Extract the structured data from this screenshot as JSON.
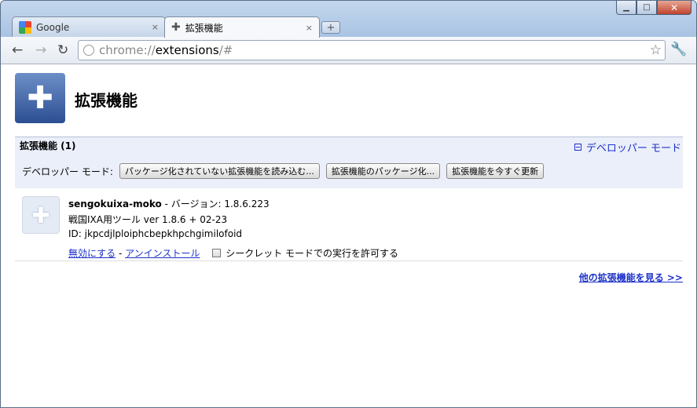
{
  "tabs": [
    {
      "title": "Google",
      "close": "×"
    },
    {
      "title": "拡張機能",
      "close": "×"
    }
  ],
  "new_tab": "+",
  "window_controls": {
    "minimize": "▁",
    "maximize": "□",
    "close": "✕"
  },
  "toolbar": {
    "back": "←",
    "forward": "→",
    "reload": "↻",
    "url": {
      "scheme": "chrome://",
      "host": "extensions",
      "rest": "/#"
    },
    "star": "☆",
    "wrench": "🔧"
  },
  "page": {
    "title": "拡張機能",
    "section_title": "拡張機能 (1)",
    "developer_mode_toggle": "デベロッパー モード",
    "developer_panel": {
      "label": "デベロッパー モード:",
      "buttons": [
        "パッケージ化されていない拡張機能を読み込む...",
        "拡張機能のパッケージ化...",
        "拡張機能を今すぐ更新"
      ]
    },
    "extension": {
      "name": "sengokuixa-moko",
      "version_text": " - バージョン: 1.8.6.223",
      "description": "戦国IXA用ツール ver 1.8.6 + 02-23",
      "id": "ID: jkpcdjlploiphcbepkhpchgimilofoid",
      "disable": "無効にする",
      "separator": " - ",
      "uninstall": "アンインストール",
      "incognito_label": "シークレット モードでの実行を許可する"
    },
    "more_extensions": "他の拡張機能を見る >>"
  },
  "icons": [
    "google-favicon",
    "puzzle-icon",
    "globe-icon",
    "star-icon",
    "wrench-icon",
    "minus-box-icon"
  ]
}
